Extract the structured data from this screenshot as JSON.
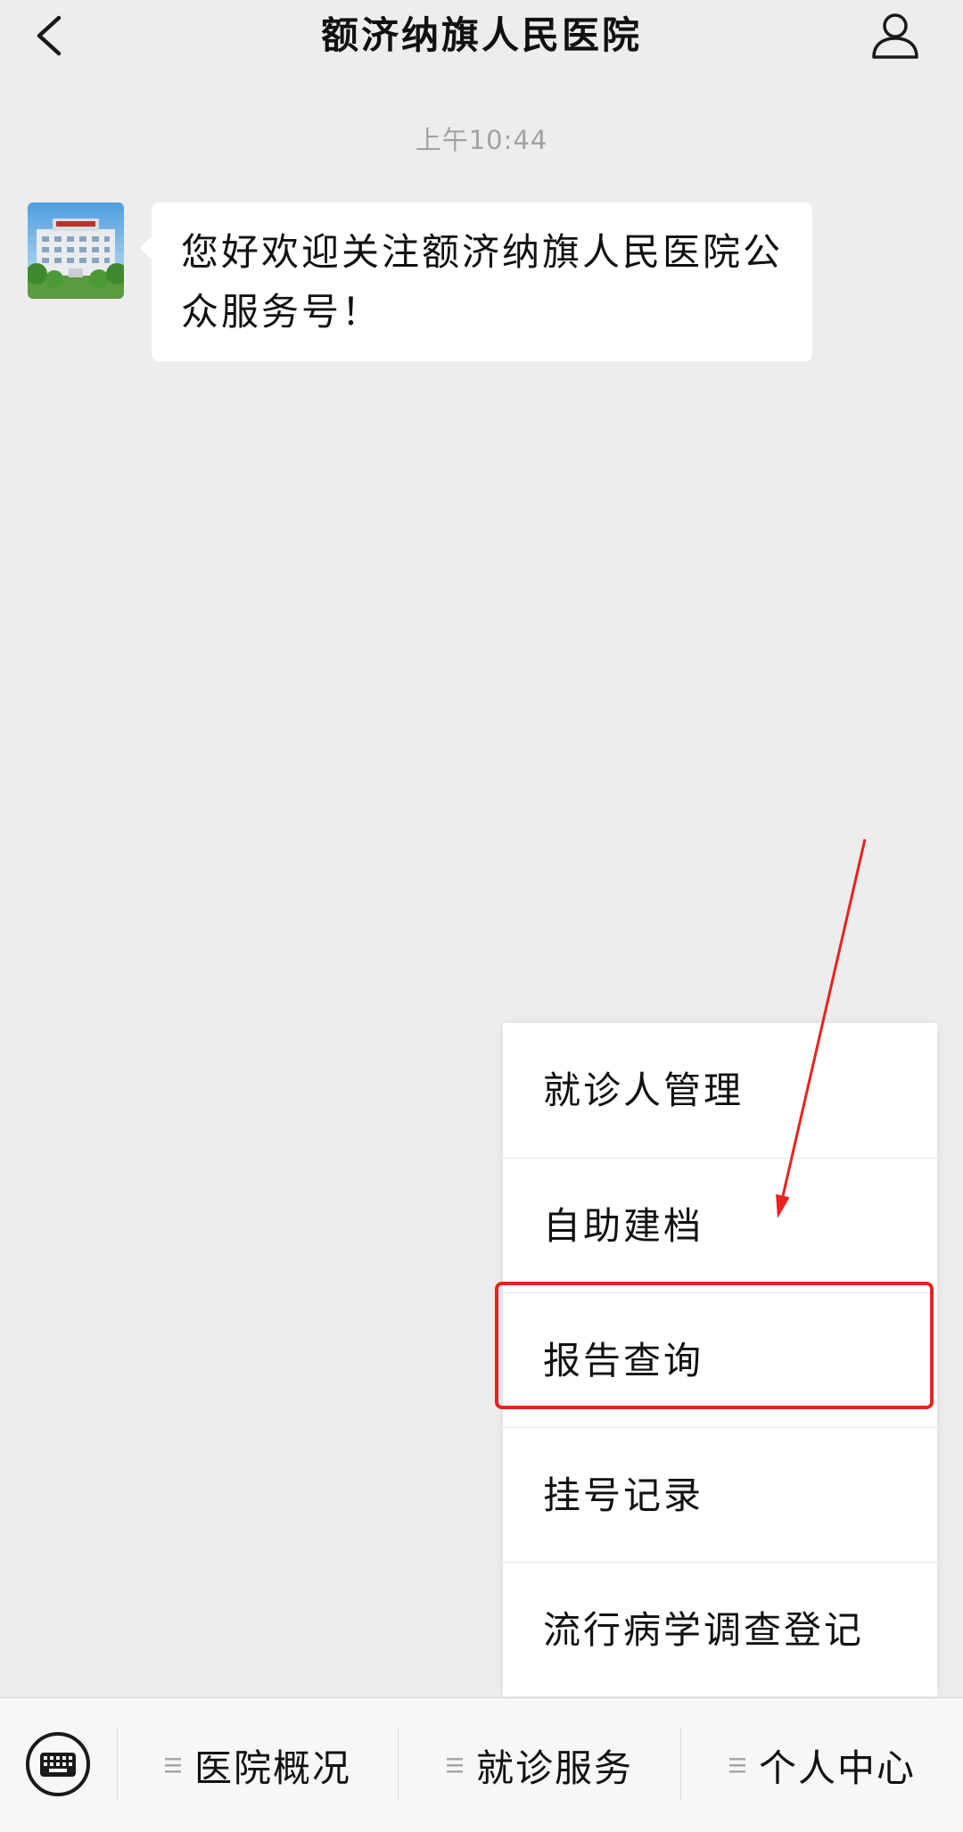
{
  "header": {
    "title": "额济纳旗人民医院",
    "back_icon": "chevron-left-icon",
    "profile_icon": "person-icon"
  },
  "chat": {
    "timestamp": "上午10:44",
    "messages": [
      {
        "sender_avatar_icon": "hospital-building-avatar",
        "text": "您好欢迎关注额济纳旗人民医院公众服务号！"
      }
    ]
  },
  "popup_menu": {
    "items": [
      {
        "label": "就诊人管理"
      },
      {
        "label": "自助建档"
      },
      {
        "label": "报告查询"
      },
      {
        "label": "挂号记录"
      },
      {
        "label": "流行病学调查登记"
      }
    ]
  },
  "bottom_bar": {
    "keyboard_icon": "keyboard-icon",
    "menus": [
      {
        "label": "医院概况",
        "icon": "menu-lines-icon"
      },
      {
        "label": "就诊服务",
        "icon": "menu-lines-icon"
      },
      {
        "label": "个人中心",
        "icon": "menu-lines-icon"
      }
    ]
  },
  "annotation": {
    "highlighted_item": "报告查询"
  },
  "colors": {
    "background": "#ededed",
    "bubble": "#ffffff",
    "timestamp": "#a2a2a2",
    "annotation": "#e8231f",
    "bottom_bar": "#f7f7f7"
  }
}
